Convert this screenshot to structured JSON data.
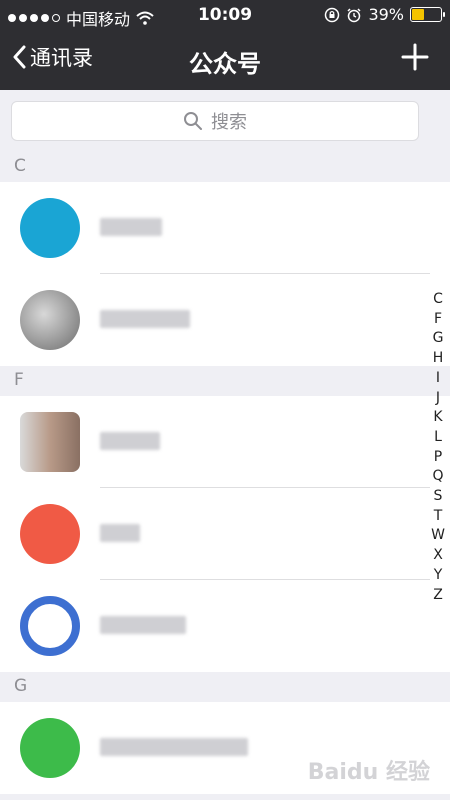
{
  "status": {
    "carrier": "中国移动",
    "time": "10:09",
    "battery_percent": "39%",
    "battery_level": 0.39
  },
  "navbar": {
    "back_label": "通讯录",
    "title": "公众号"
  },
  "search": {
    "placeholder": "搜索"
  },
  "sections": [
    {
      "letter": "C",
      "items": [
        {
          "avatar_color": "#1aa5d4"
        },
        {
          "avatar_color": "#8a8a8a"
        }
      ]
    },
    {
      "letter": "F",
      "items": [
        {
          "avatar_color": "#b89a88"
        },
        {
          "avatar_color": "#f05a45"
        },
        {
          "avatar_color": "#3d6fd1"
        }
      ]
    },
    {
      "letter": "G",
      "items": [
        {
          "avatar_color": "#3dbb4a"
        }
      ]
    }
  ],
  "index_letters": [
    "C",
    "F",
    "G",
    "H",
    "I",
    "J",
    "K",
    "L",
    "P",
    "Q",
    "S",
    "T",
    "W",
    "X",
    "Y",
    "Z"
  ],
  "watermark": "Baidu 经验"
}
